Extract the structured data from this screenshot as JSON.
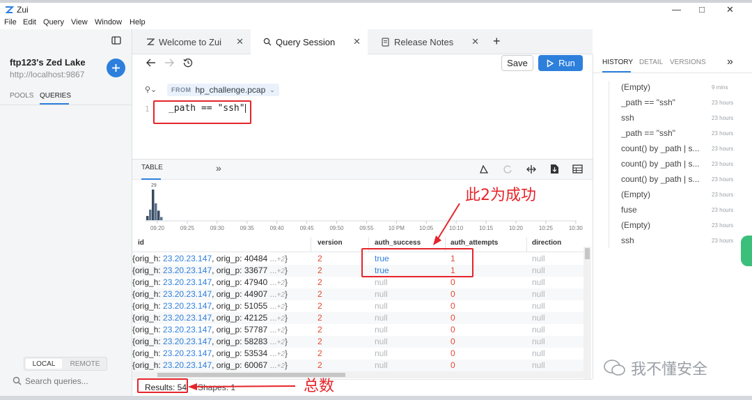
{
  "window": {
    "title": "Zui",
    "controls": [
      "—",
      "□",
      "✕"
    ]
  },
  "menu": [
    "File",
    "Edit",
    "Query",
    "View",
    "Window",
    "Help"
  ],
  "sidebar": {
    "lake_name": "ftp123's Zed Lake",
    "lake_url": "http://localhost:9867",
    "tabs": [
      "POOLS",
      "QUERIES"
    ],
    "active_tab": "QUERIES",
    "bottom_tabs": [
      "LOCAL",
      "REMOTE"
    ],
    "search_placeholder": "Search queries..."
  },
  "tabs": [
    {
      "label": "Welcome to Zui",
      "icon": "zui-logo-icon"
    },
    {
      "label": "Query Session",
      "icon": "search-icon",
      "active": true
    },
    {
      "label": "Release Notes",
      "icon": "document-icon"
    }
  ],
  "query": {
    "save_label": "Save",
    "run_label": "Run",
    "from_keyword": "FROM",
    "pool": "hp_challenge.pcap",
    "line_number": "1",
    "text": "_path == \"ssh\""
  },
  "results": {
    "tab_label": "TABLE",
    "histogram": {
      "peak_label": "29",
      "time_ticks": [
        "09:20",
        "09:25",
        "09:30",
        "09:35",
        "09:40",
        "09:45",
        "09:50",
        "09:55",
        "10 PM",
        "10:05",
        "10:10",
        "10:15",
        "10:20",
        "10:25",
        "10:30"
      ],
      "bars_at_start_relative": [
        4,
        10,
        29,
        16,
        9,
        3
      ]
    },
    "columns": [
      "id",
      "version",
      "auth_success",
      "auth_attempts",
      "direction"
    ],
    "rows": [
      {
        "id_prefix": "{orig_h: ",
        "ip": "23.20.23.147",
        "mid": ", orig_p: ",
        "port": "40484",
        "more": "...",
        "more_count": "+2",
        "version": "2",
        "auth_success": "true",
        "auth_attempts": "1",
        "direction": "null"
      },
      {
        "id_prefix": "{orig_h: ",
        "ip": "23.20.23.147",
        "mid": ", orig_p: ",
        "port": "33677",
        "more": "...",
        "more_count": "+2",
        "version": "2",
        "auth_success": "true",
        "auth_attempts": "1",
        "direction": "null"
      },
      {
        "id_prefix": "{orig_h: ",
        "ip": "23.20.23.147",
        "mid": ", orig_p: ",
        "port": "47940",
        "more": "...",
        "more_count": "+2",
        "version": "2",
        "auth_success": "null",
        "auth_attempts": "0",
        "direction": "null"
      },
      {
        "id_prefix": "{orig_h: ",
        "ip": "23.20.23.147",
        "mid": ", orig_p: ",
        "port": "44907",
        "more": "...",
        "more_count": "+2",
        "version": "2",
        "auth_success": "null",
        "auth_attempts": "0",
        "direction": "null"
      },
      {
        "id_prefix": "{orig_h: ",
        "ip": "23.20.23.147",
        "mid": ", orig_p: ",
        "port": "51055",
        "more": "...",
        "more_count": "+2",
        "version": "2",
        "auth_success": "null",
        "auth_attempts": "0",
        "direction": "null"
      },
      {
        "id_prefix": "{orig_h: ",
        "ip": "23.20.23.147",
        "mid": ", orig_p: ",
        "port": "42125",
        "more": "...",
        "more_count": "+2",
        "version": "2",
        "auth_success": "null",
        "auth_attempts": "0",
        "direction": "null"
      },
      {
        "id_prefix": "{orig_h: ",
        "ip": "23.20.23.147",
        "mid": ", orig_p: ",
        "port": "57787",
        "more": "...",
        "more_count": "+2",
        "version": "2",
        "auth_success": "null",
        "auth_attempts": "0",
        "direction": "null"
      },
      {
        "id_prefix": "{orig_h: ",
        "ip": "23.20.23.147",
        "mid": ", orig_p: ",
        "port": "58283",
        "more": "...",
        "more_count": "+2",
        "version": "2",
        "auth_success": "null",
        "auth_attempts": "0",
        "direction": "null"
      },
      {
        "id_prefix": "{orig_h: ",
        "ip": "23.20.23.147",
        "mid": ", orig_p: ",
        "port": "53534",
        "more": "...",
        "more_count": "+2",
        "version": "2",
        "auth_success": "null",
        "auth_attempts": "0",
        "direction": "null"
      },
      {
        "id_prefix": "{orig_h: ",
        "ip": "23.20.23.147",
        "mid": ", orig_p: ",
        "port": "60067",
        "more": "...",
        "more_count": "+2",
        "version": "2",
        "auth_success": "null",
        "auth_attempts": "0",
        "direction": "null"
      }
    ],
    "status": {
      "results_label": "Results: 54",
      "shapes_label": "Shapes: 1"
    }
  },
  "history_panel": {
    "tabs": [
      "HISTORY",
      "DETAIL",
      "VERSIONS"
    ],
    "active_tab": "HISTORY",
    "items": [
      {
        "query": "(Empty)",
        "time": "9 mins"
      },
      {
        "query": "_path == \"ssh\"",
        "time": "23 hours"
      },
      {
        "query": "ssh",
        "time": "23 hours"
      },
      {
        "query": "_path == \"ssh\"",
        "time": "23 hours"
      },
      {
        "query": "count() by _path | s...",
        "time": "23 hours"
      },
      {
        "query": "count() by _path | s...",
        "time": "23 hours"
      },
      {
        "query": "count() by _path | s...",
        "time": "23 hours"
      },
      {
        "query": "(Empty)",
        "time": "23 hours"
      },
      {
        "query": "fuse",
        "time": "23 hours"
      },
      {
        "query": "(Empty)",
        "time": "23 hours"
      },
      {
        "query": "ssh",
        "time": "23 hours"
      }
    ]
  },
  "annotations": {
    "success_note": "此2为成功",
    "total_note": "总数",
    "watermark": "我不懂安全"
  },
  "colors": {
    "accent": "#2d7fdc",
    "annotation": "#e5242a",
    "version_red": "#e0482f"
  }
}
